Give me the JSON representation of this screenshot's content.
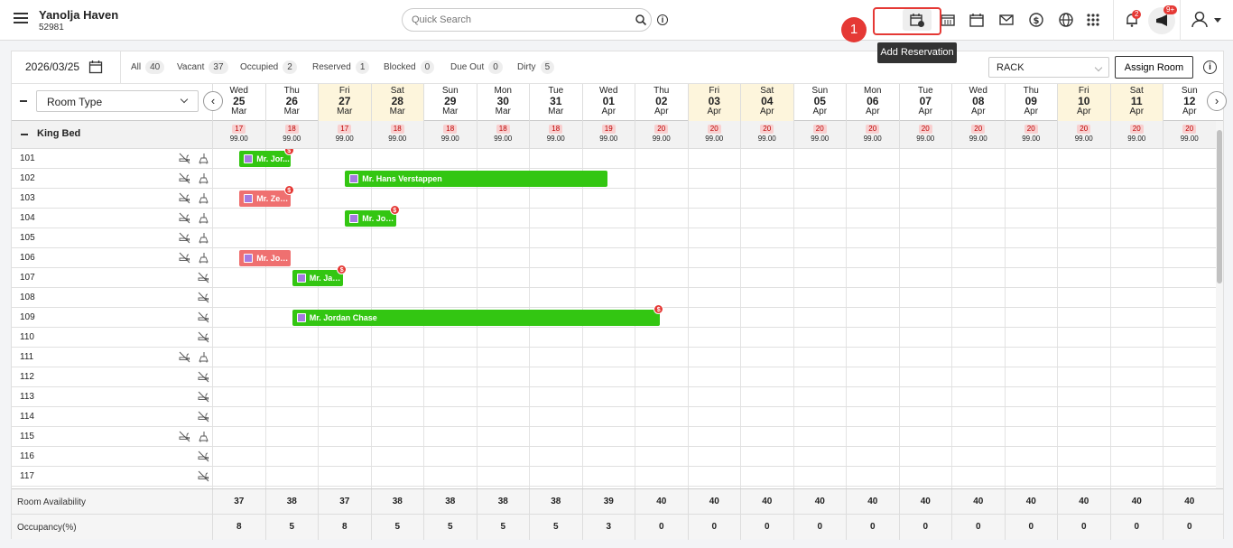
{
  "header": {
    "hotel_name": "Yanolja Haven",
    "hotel_code": "52981",
    "search_placeholder": "Quick Search",
    "notif_badge": "2",
    "announce_badge": "9+",
    "step_number": "1",
    "tooltip": "Add Reservation"
  },
  "toolbar": {
    "date": "2026/03/25",
    "filters": [
      {
        "label": "All",
        "count": "40"
      },
      {
        "label": "Vacant",
        "count": "37"
      },
      {
        "label": "Occupied",
        "count": "2"
      },
      {
        "label": "Reserved",
        "count": "1"
      },
      {
        "label": "Blocked",
        "count": "0"
      },
      {
        "label": "Due Out",
        "count": "0"
      },
      {
        "label": "Dirty",
        "count": "5"
      }
    ],
    "rate_plan": "RACK",
    "assign_label": "Assign Room"
  },
  "room_type_select": "Room Type",
  "dates": [
    {
      "dow": "Wed",
      "day": "25",
      "mon": "Mar",
      "weekend": false
    },
    {
      "dow": "Thu",
      "day": "26",
      "mon": "Mar",
      "weekend": false
    },
    {
      "dow": "Fri",
      "day": "27",
      "mon": "Mar",
      "weekend": true
    },
    {
      "dow": "Sat",
      "day": "28",
      "mon": "Mar",
      "weekend": true
    },
    {
      "dow": "Sun",
      "day": "29",
      "mon": "Mar",
      "weekend": false
    },
    {
      "dow": "Mon",
      "day": "30",
      "mon": "Mar",
      "weekend": false
    },
    {
      "dow": "Tue",
      "day": "31",
      "mon": "Mar",
      "weekend": false
    },
    {
      "dow": "Wed",
      "day": "01",
      "mon": "Apr",
      "weekend": false
    },
    {
      "dow": "Thu",
      "day": "02",
      "mon": "Apr",
      "weekend": false
    },
    {
      "dow": "Fri",
      "day": "03",
      "mon": "Apr",
      "weekend": true
    },
    {
      "dow": "Sat",
      "day": "04",
      "mon": "Apr",
      "weekend": true
    },
    {
      "dow": "Sun",
      "day": "05",
      "mon": "Apr",
      "weekend": false
    },
    {
      "dow": "Mon",
      "day": "06",
      "mon": "Apr",
      "weekend": false
    },
    {
      "dow": "Tue",
      "day": "07",
      "mon": "Apr",
      "weekend": false
    },
    {
      "dow": "Wed",
      "day": "08",
      "mon": "Apr",
      "weekend": false
    },
    {
      "dow": "Thu",
      "day": "09",
      "mon": "Apr",
      "weekend": false
    },
    {
      "dow": "Fri",
      "day": "10",
      "mon": "Apr",
      "weekend": true
    },
    {
      "dow": "Sat",
      "day": "11",
      "mon": "Apr",
      "weekend": true
    },
    {
      "dow": "Sun",
      "day": "12",
      "mon": "Apr",
      "weekend": false
    }
  ],
  "group": {
    "name": "King Bed",
    "counts": [
      "17",
      "18",
      "17",
      "18",
      "18",
      "18",
      "18",
      "19",
      "20",
      "20",
      "20",
      "20",
      "20",
      "20",
      "20",
      "20",
      "20",
      "20",
      "20"
    ],
    "price": "99.00"
  },
  "rooms": [
    {
      "num": "101",
      "icons": 2
    },
    {
      "num": "102",
      "icons": 2
    },
    {
      "num": "103",
      "icons": 2
    },
    {
      "num": "104",
      "icons": 2
    },
    {
      "num": "105",
      "icons": 2
    },
    {
      "num": "106",
      "icons": 2
    },
    {
      "num": "107",
      "icons": 1
    },
    {
      "num": "108",
      "icons": 1
    },
    {
      "num": "109",
      "icons": 1
    },
    {
      "num": "110",
      "icons": 1
    },
    {
      "num": "111",
      "icons": 2
    },
    {
      "num": "112",
      "icons": 1
    },
    {
      "num": "113",
      "icons": 1
    },
    {
      "num": "114",
      "icons": 1
    },
    {
      "num": "115",
      "icons": 2
    },
    {
      "num": "116",
      "icons": 1
    },
    {
      "num": "117",
      "icons": 1
    }
  ],
  "reservations": [
    {
      "room": 0,
      "start": 0,
      "nights": 1,
      "name": "Mr. Jor...",
      "color": "g",
      "badge": "$"
    },
    {
      "room": 1,
      "start": 2,
      "nights": 5,
      "name": "Mr. Hans Verstappen",
      "color": "g",
      "badge": ""
    },
    {
      "room": 2,
      "start": 0,
      "nights": 1,
      "name": "Mr. Zeb...",
      "color": "r",
      "badge": "$"
    },
    {
      "room": 3,
      "start": 2,
      "nights": 1,
      "name": "Mr. Joh...",
      "color": "g",
      "badge": "$"
    },
    {
      "room": 5,
      "start": 0,
      "nights": 1,
      "name": "Mr. Joh...",
      "color": "r",
      "badge": ""
    },
    {
      "room": 6,
      "start": 1,
      "nights": 1,
      "name": "Mr. Jas...",
      "color": "g",
      "badge": "$"
    },
    {
      "room": 8,
      "start": 1,
      "nights": 7,
      "name": "Mr. Jordan Chase",
      "color": "g",
      "badge": "$"
    }
  ],
  "footer": {
    "availability_label": "Room Availability",
    "availability": [
      "37",
      "38",
      "37",
      "38",
      "38",
      "38",
      "38",
      "39",
      "40",
      "40",
      "40",
      "40",
      "40",
      "40",
      "40",
      "40",
      "40",
      "40",
      "40"
    ],
    "occupancy_label": "Occupancy(%)",
    "occupancy": [
      "8",
      "5",
      "8",
      "5",
      "5",
      "5",
      "5",
      "3",
      "0",
      "0",
      "0",
      "0",
      "0",
      "0",
      "0",
      "0",
      "0",
      "0",
      "0"
    ]
  }
}
